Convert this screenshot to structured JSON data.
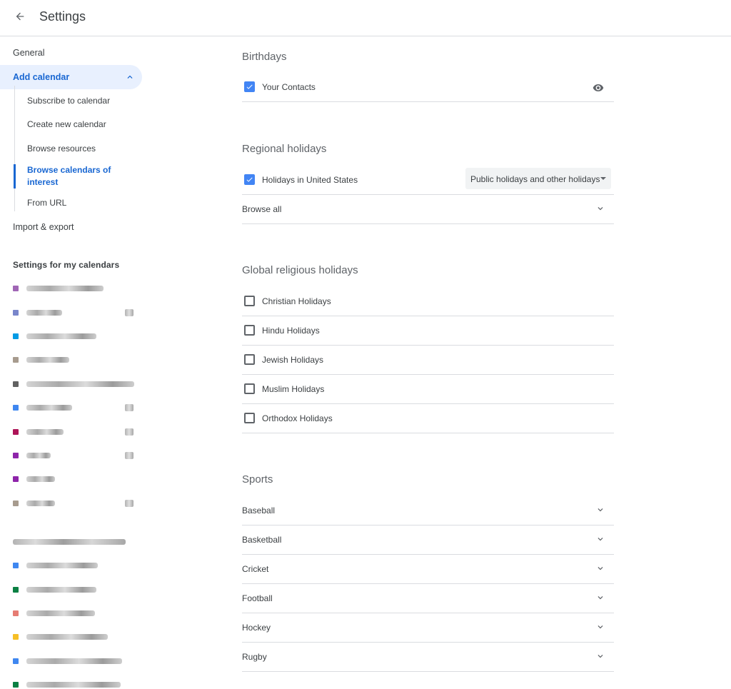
{
  "header": {
    "title": "Settings"
  },
  "sidebar": {
    "general": "General",
    "add_calendar": "Add calendar",
    "sub_items": [
      "Subscribe to calendar",
      "Create new calendar",
      "Browse resources",
      "Browse calendars of interest",
      "From URL"
    ],
    "import_export": "Import & export",
    "my_calendars_heading": "Settings for my calendars",
    "my_calendar_colors": [
      "#a066b5",
      "#7986cb",
      "#039be5",
      "#a79b8e",
      "#616161",
      "#3f87f0",
      "#ad1457",
      "#8e24aa",
      "#8e24aa",
      "#a79b8e"
    ],
    "other_calendar_colors": [
      "#3f87f0",
      "#0b8043",
      "#e67c73",
      "#f6bf26",
      "#3f87f0",
      "#0b8043"
    ]
  },
  "main": {
    "birthdays": {
      "title": "Birthdays",
      "contacts_label": "Your Contacts"
    },
    "regional": {
      "title": "Regional holidays",
      "holiday_label": "Holidays in United States",
      "holiday_type": "Public holidays and other holidays",
      "browse_all": "Browse all"
    },
    "religious": {
      "title": "Global religious holidays",
      "items": [
        "Christian Holidays",
        "Hindu Holidays",
        "Jewish Holidays",
        "Muslim Holidays",
        "Orthodox Holidays"
      ]
    },
    "sports": {
      "title": "Sports",
      "items": [
        "Baseball",
        "Basketball",
        "Cricket",
        "Football",
        "Hockey",
        "Rugby"
      ]
    }
  }
}
